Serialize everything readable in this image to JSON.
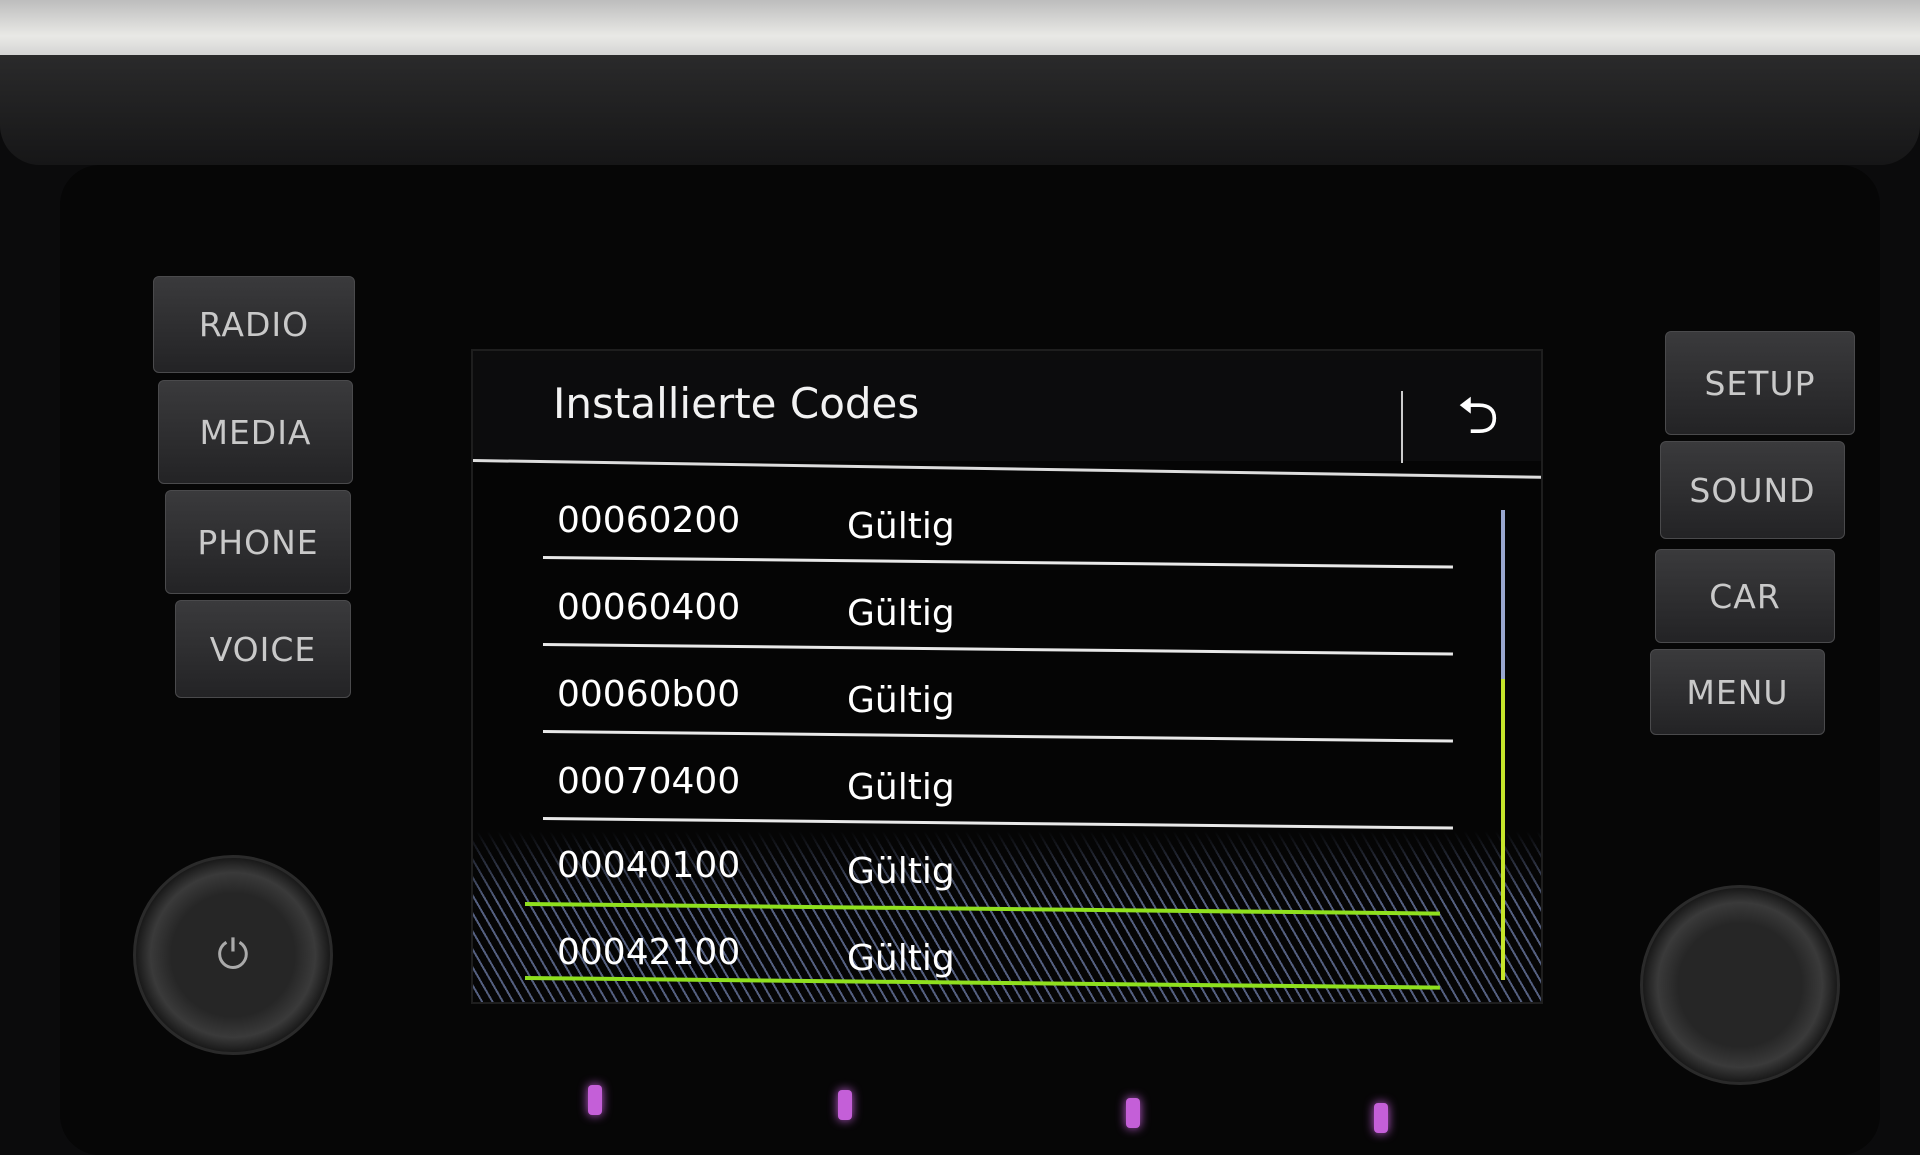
{
  "hardware_buttons": {
    "left": [
      "RADIO",
      "MEDIA",
      "PHONE",
      "VOICE"
    ],
    "right": [
      "SETUP",
      "SOUND",
      "CAR",
      "MENU"
    ],
    "power_knob_icon": "power-icon"
  },
  "screen": {
    "title": "Installierte Codes",
    "back_icon": "back-arrow-icon",
    "rows": [
      {
        "code": "00060200",
        "status": "Gültig"
      },
      {
        "code": "00060400",
        "status": "Gültig"
      },
      {
        "code": "00060b00",
        "status": "Gültig"
      },
      {
        "code": "00070400",
        "status": "Gültig"
      },
      {
        "code": "00040100",
        "status": "Gültig"
      },
      {
        "code": "00042100",
        "status": "Gültig"
      }
    ],
    "selected_index": 5,
    "scroll_position_fraction": 1.0,
    "accent_color": "#8fe01e"
  }
}
